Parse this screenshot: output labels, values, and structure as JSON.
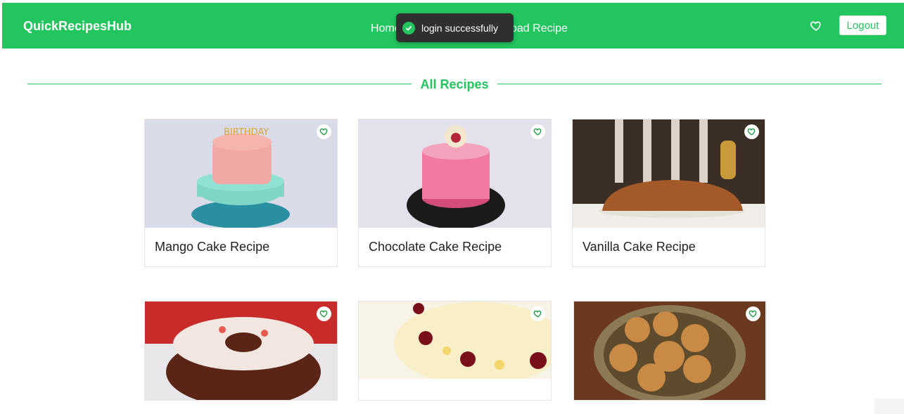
{
  "navbar": {
    "brand": "QuickRecipesHub",
    "links": [
      "Home",
      "Upload Recipe"
    ],
    "favorites_icon": "heart-icon",
    "logout_label": "Logout",
    "color": "#22c55e"
  },
  "toast": {
    "message": "login successfully",
    "icon": "check-circle-icon"
  },
  "section": {
    "title": "All Recipes"
  },
  "recipes": [
    {
      "title": "Mango Cake Recipe",
      "image": "birthday-cake-photo"
    },
    {
      "title": "Chocolate Cake Recipe",
      "image": "pink-mirror-cake-photo"
    },
    {
      "title": "Vanilla Cake Recipe",
      "image": "loaf-cake-photo"
    },
    {
      "title": "",
      "image": "bundt-cake-photo"
    },
    {
      "title": "",
      "image": "cream-fruit-cake-photo"
    },
    {
      "title": "",
      "image": "cookies-plate-photo"
    }
  ]
}
